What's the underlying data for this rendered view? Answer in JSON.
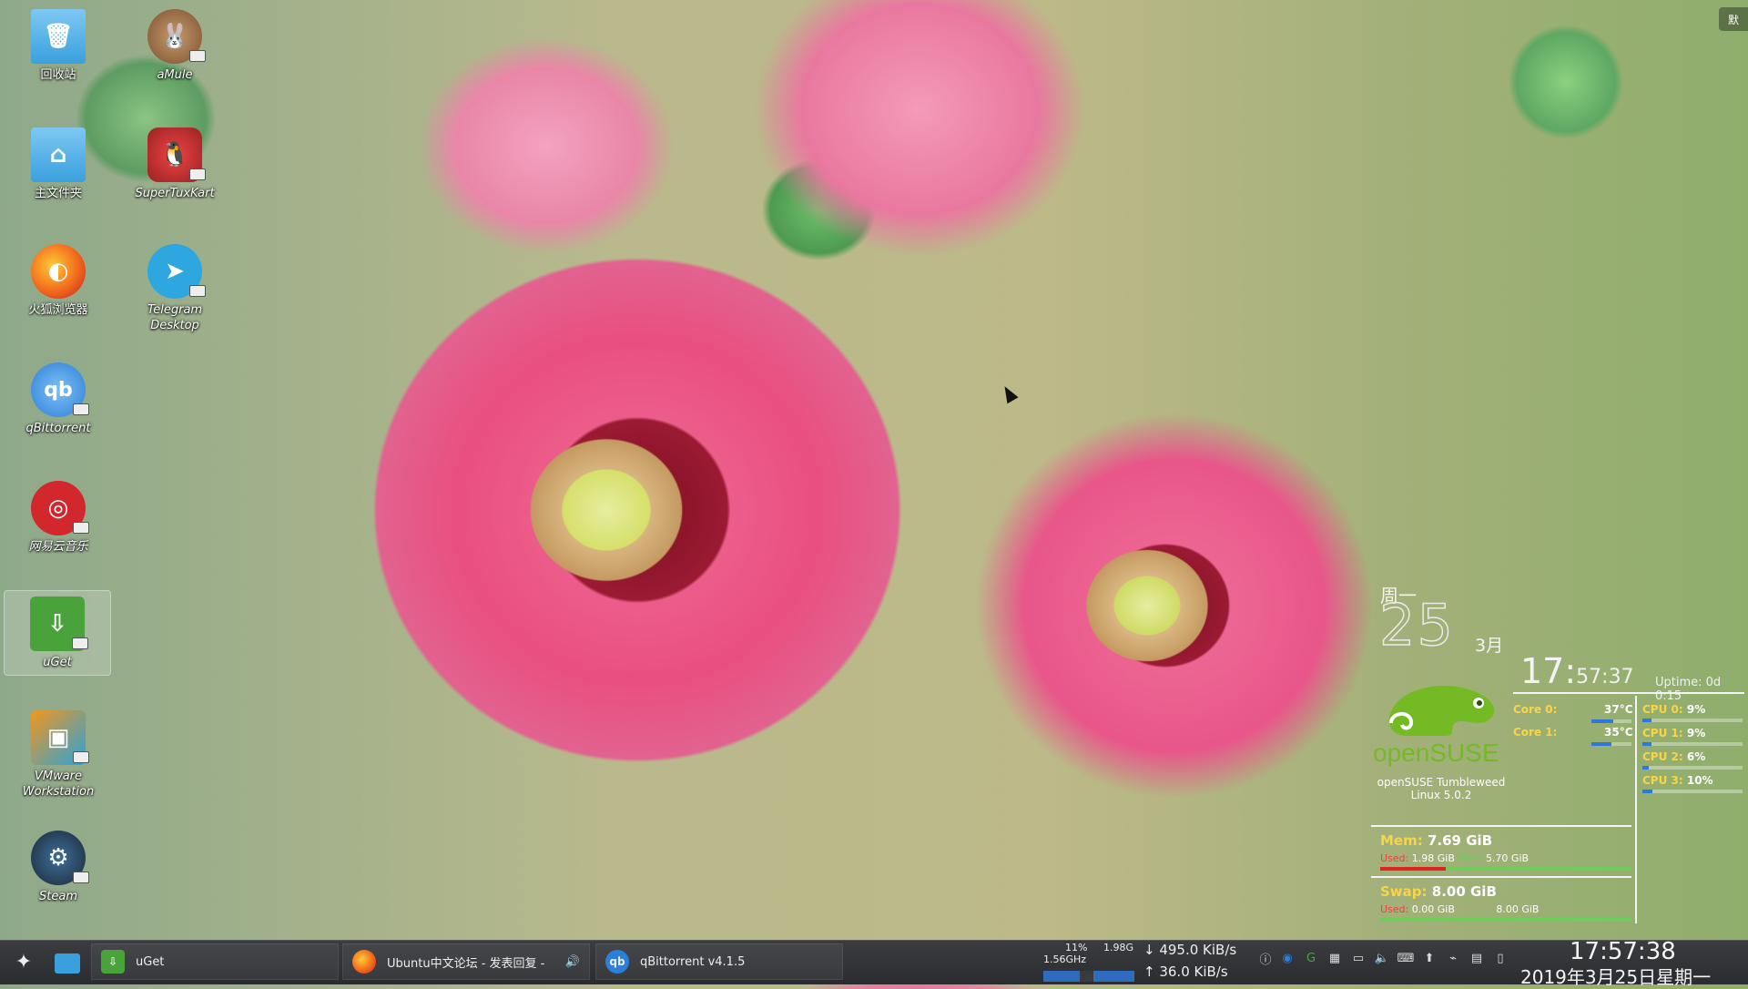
{
  "desktop": {
    "icons": [
      {
        "label": "回收站"
      },
      {
        "label": "aMule"
      },
      {
        "label": "主文件夹"
      },
      {
        "label": "SuperTuxKart"
      },
      {
        "label": "火狐浏览器"
      },
      {
        "label": "Telegram Desktop"
      },
      {
        "label": "qBittorrent"
      },
      {
        "label": "网易云音乐"
      },
      {
        "label": "uGet"
      },
      {
        "label": "VMware Workstation"
      },
      {
        "label": "Steam"
      }
    ],
    "top_right_label": "默"
  },
  "widget": {
    "weekday": "周一",
    "day": "25",
    "month": "3月",
    "time_hm": "17:",
    "time_sec": "57:37",
    "uptime": "Uptime: 0d 0:15",
    "os_name": "openSUSE Tumbleweed",
    "kernel": "Linux 5.0.2",
    "logo_text": "openSUSE",
    "cores": [
      {
        "label": "Core 0:",
        "temp": "37°C",
        "level": 0.55
      },
      {
        "label": "Core 1:",
        "temp": "35°C",
        "level": 0.5
      }
    ],
    "cpus": [
      {
        "label": "CPU 0:",
        "value": "9%",
        "level": 0.09
      },
      {
        "label": "CPU 1:",
        "value": "9%",
        "level": 0.09
      },
      {
        "label": "CPU 2:",
        "value": "6%",
        "level": 0.06
      },
      {
        "label": "CPU 3:",
        "value": "10%",
        "level": 0.1
      }
    ],
    "mem": {
      "title": "Mem:",
      "total": "7.69 GiB",
      "used_label": "Used:",
      "used": "1.98 GiB",
      "free_label": "Free:",
      "free": "5.70 GiB",
      "level": 0.26
    },
    "swap": {
      "title": "Swap:",
      "total": "8.00 GiB",
      "used_label": "Used:",
      "used": "0.00 GiB",
      "free": "8.00 GiB",
      "level": 0.0
    }
  },
  "taskbar": {
    "tasks": [
      {
        "label": "uGet"
      },
      {
        "label": "Ubuntu中文论坛 - 发表回复 -"
      },
      {
        "label": "qBittorrent v4.1.5"
      }
    ],
    "cpu_pct": "11%",
    "cpu_freq": "1.56GHz",
    "mem": "1.98G",
    "down": "↓ 495.0 KiB/s",
    "up": "↑   36.0 KiB/s",
    "clock": "17:57:38",
    "date": "2019年3月25日星期一"
  },
  "colors": {
    "accent": "#f8d44a",
    "opensuse_green": "#73ba25",
    "bar_blue": "#2f77d9"
  }
}
